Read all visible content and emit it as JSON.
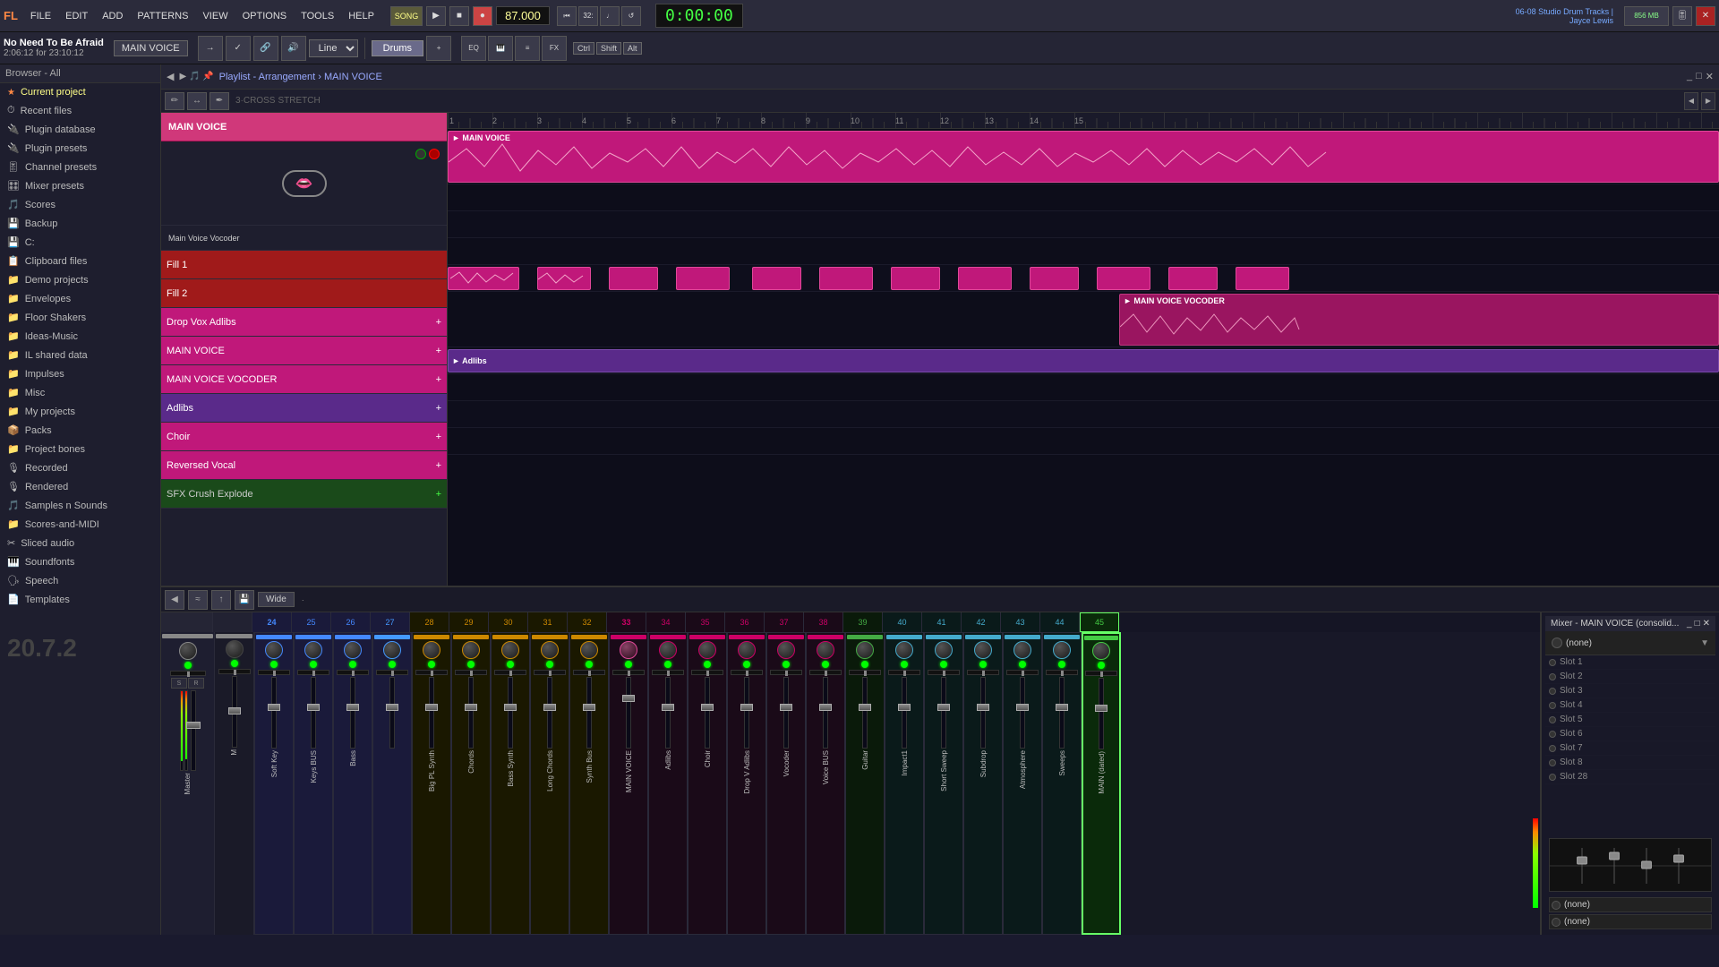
{
  "app": {
    "title": "FL Studio 20.7.2",
    "version": "20.7.2"
  },
  "menu": {
    "items": [
      "FILE",
      "EDIT",
      "ADD",
      "PATTERNS",
      "VIEW",
      "OPTIONS",
      "TOOLS",
      "HELP"
    ]
  },
  "transport": {
    "bpm": "87.000",
    "time": "0:00:00",
    "play_label": "▶",
    "stop_label": "■",
    "record_label": "●",
    "song_btn": "SONG"
  },
  "song": {
    "title": "No Need To Be Afraid",
    "time": "2:06:12 for 23:10:12",
    "pattern": "MAIN VOICE"
  },
  "toolbar2": {
    "line_mode": "Line",
    "channel": "Drums",
    "shortcut_keys": [
      "Ctrl",
      "Shift",
      "Alt"
    ],
    "studio_info": "06-08 Studio Drum Tracks |\nJayce Lewis"
  },
  "playlist": {
    "title": "Playlist - Arrangement",
    "breadcrumb": "MAIN VOICE",
    "toolbar": {
      "wide_btn": "Wide"
    },
    "tracks": [
      {
        "name": "MAIN VOICE",
        "color": "pink",
        "type": "audio"
      },
      {
        "name": "Fill 1",
        "color": "red",
        "type": "pattern"
      },
      {
        "name": "Fill 2",
        "color": "red",
        "type": "pattern"
      },
      {
        "name": "Drop Vox Adlibs",
        "color": "pink",
        "type": "pattern"
      },
      {
        "name": "MAIN VOICE",
        "color": "pink",
        "type": "pattern"
      },
      {
        "name": "MAIN VOICE VOCODER",
        "color": "pink",
        "type": "pattern"
      },
      {
        "name": "Adlibs",
        "color": "purple",
        "type": "pattern"
      },
      {
        "name": "Choir",
        "color": "pink",
        "type": "pattern"
      },
      {
        "name": "Reversed Vocal",
        "color": "pink",
        "type": "pattern"
      },
      {
        "name": "SFX Crush Explode",
        "color": "green",
        "type": "pattern"
      }
    ]
  },
  "mixer": {
    "title": "Mixer - MAIN VOICE (consolid...",
    "channels": [
      {
        "num": "",
        "name": "Master",
        "color": "#888"
      },
      {
        "num": "",
        "name": "M",
        "color": "#888"
      },
      {
        "num": "24",
        "name": "",
        "color": "#4488ff"
      },
      {
        "num": "25",
        "name": "Soft Key",
        "color": "#4488ff"
      },
      {
        "num": "26",
        "name": "Keys BUS",
        "color": "#4488ff"
      },
      {
        "num": "27",
        "name": "Bass",
        "color": "#4499ff"
      },
      {
        "num": "28",
        "name": "Big PL Synth",
        "color": "#cc8800"
      },
      {
        "num": "29",
        "name": "Chords",
        "color": "#cc8800"
      },
      {
        "num": "30",
        "name": "Bass Synth",
        "color": "#cc8800"
      },
      {
        "num": "31",
        "name": "Long Chords",
        "color": "#cc8800"
      },
      {
        "num": "32",
        "name": "Synth Bus",
        "color": "#cc8800"
      },
      {
        "num": "33",
        "name": "MAIN VOICE",
        "color": "#cc0066"
      },
      {
        "num": "34",
        "name": "Adlibs",
        "color": "#cc0066"
      },
      {
        "num": "35",
        "name": "Choir",
        "color": "#cc0066"
      },
      {
        "num": "36",
        "name": "Drop V Adlibs",
        "color": "#cc0066"
      },
      {
        "num": "37",
        "name": "Vocoder",
        "color": "#cc0066"
      },
      {
        "num": "38",
        "name": "Voice BUS",
        "color": "#cc0066"
      },
      {
        "num": "39",
        "name": "Guitar",
        "color": "#44aa44"
      },
      {
        "num": "40",
        "name": "Impact1",
        "color": "#44aacc"
      },
      {
        "num": "41",
        "name": "Short Sweep",
        "color": "#44aacc"
      },
      {
        "num": "42",
        "name": "Subdrop",
        "color": "#44aacc"
      },
      {
        "num": "43",
        "name": "Atmosphere",
        "color": "#44aacc"
      },
      {
        "num": "44",
        "name": "Sweeps",
        "color": "#44aacc"
      },
      {
        "num": "45",
        "name": "MAIN (dated)",
        "color": "#44cc44"
      }
    ]
  },
  "mixer_right": {
    "title": "Mixer - MAIN VOICE (consolid...",
    "none_label": "(none)",
    "slots": [
      {
        "name": "Slot 1"
      },
      {
        "name": "Slot 2"
      },
      {
        "name": "Slot 3"
      },
      {
        "name": "Slot 4"
      },
      {
        "name": "Slot 5"
      },
      {
        "name": "Slot 6"
      },
      {
        "name": "Slot 7"
      },
      {
        "name": "Slot 8"
      },
      {
        "name": "Slot 28"
      }
    ]
  },
  "sidebar": {
    "header": "Browser - All",
    "items": [
      {
        "icon": "★",
        "label": "Current project",
        "type": "special"
      },
      {
        "icon": "⏱",
        "label": "Recent files",
        "type": "folder"
      },
      {
        "icon": "🔌",
        "label": "Plugin database",
        "type": "folder"
      },
      {
        "icon": "🔌",
        "label": "Plugin presets",
        "type": "folder"
      },
      {
        "icon": "🎚",
        "label": "Channel presets",
        "type": "folder"
      },
      {
        "icon": "🎛",
        "label": "Mixer presets",
        "type": "folder"
      },
      {
        "icon": "🎵",
        "label": "Scores",
        "type": "folder"
      },
      {
        "icon": "💾",
        "label": "Backup",
        "type": "folder"
      },
      {
        "icon": "💾",
        "label": "C:",
        "type": "folder"
      },
      {
        "icon": "📋",
        "label": "Clipboard files",
        "type": "folder"
      },
      {
        "icon": "📁",
        "label": "Demo projects",
        "type": "folder"
      },
      {
        "icon": "📁",
        "label": "Envelopes",
        "type": "folder"
      },
      {
        "icon": "📁",
        "label": "Floor Shakers",
        "type": "folder"
      },
      {
        "icon": "📁",
        "label": "Ideas-Music",
        "type": "folder"
      },
      {
        "icon": "📁",
        "label": "IL shared data",
        "type": "folder"
      },
      {
        "icon": "📁",
        "label": "Impulses",
        "type": "folder"
      },
      {
        "icon": "📁",
        "label": "Misc",
        "type": "folder"
      },
      {
        "icon": "📁",
        "label": "My projects",
        "type": "folder"
      },
      {
        "icon": "📦",
        "label": "Packs",
        "type": "folder"
      },
      {
        "icon": "📁",
        "label": "Project bones",
        "type": "folder"
      },
      {
        "icon": "🎙",
        "label": "Recorded",
        "type": "folder"
      },
      {
        "icon": "🎙",
        "label": "Rendered",
        "type": "folder"
      },
      {
        "icon": "🎵",
        "label": "Samples n Sounds",
        "type": "folder"
      },
      {
        "icon": "📁",
        "label": "Scores-and-MIDI",
        "type": "folder"
      },
      {
        "icon": "✂",
        "label": "Sliced audio",
        "type": "folder"
      },
      {
        "icon": "🎹",
        "label": "Soundfonts",
        "type": "folder"
      },
      {
        "icon": "🗣",
        "label": "Speech",
        "type": "folder"
      },
      {
        "icon": "📄",
        "label": "Templates",
        "type": "folder"
      }
    ]
  }
}
